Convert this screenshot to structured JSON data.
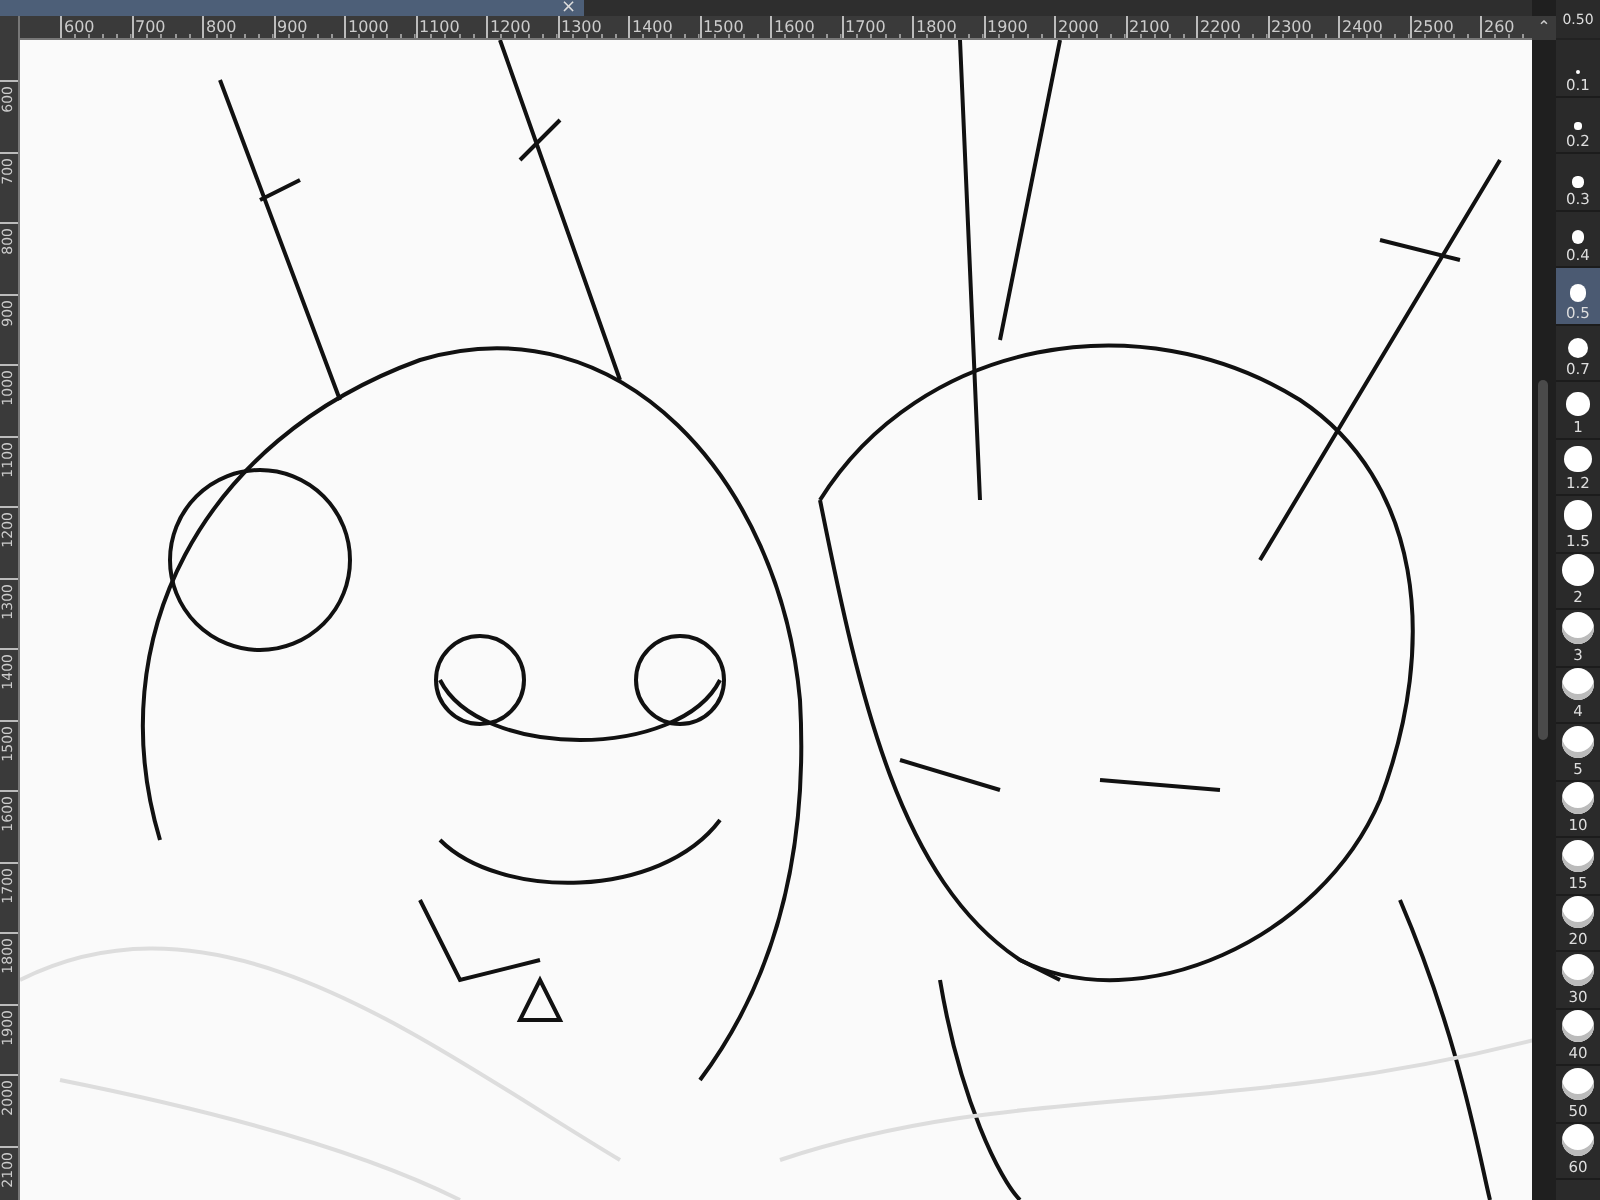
{
  "document_tab": {
    "close_glyph": "×"
  },
  "scroll_up_glyph": "⌃",
  "top_ruler": [
    "600",
    "700",
    "800",
    "900",
    "1000",
    "1100",
    "1200",
    "1300",
    "1400",
    "1500",
    "1600",
    "1700",
    "1800",
    "1900",
    "2000",
    "2100",
    "2200",
    "2300",
    "2400",
    "2500",
    "260"
  ],
  "left_ruler": [
    "600",
    "700",
    "800",
    "900",
    "1000",
    "1100",
    "1200",
    "1300",
    "1400",
    "1500",
    "1600",
    "1700",
    "1800",
    "1900",
    "2000",
    "2100"
  ],
  "brush_size_panel": {
    "current": "0.50",
    "sizes": [
      {
        "label": "0.1",
        "selected": false
      },
      {
        "label": "0.2",
        "selected": false
      },
      {
        "label": "0.3",
        "selected": false
      },
      {
        "label": "0.4",
        "selected": false
      },
      {
        "label": "0.5",
        "selected": true
      },
      {
        "label": "0.7",
        "selected": false
      },
      {
        "label": "1",
        "selected": false
      },
      {
        "label": "1.2",
        "selected": false
      },
      {
        "label": "1.5",
        "selected": false
      },
      {
        "label": "2",
        "selected": false
      },
      {
        "label": "3",
        "selected": false
      },
      {
        "label": "4",
        "selected": false
      },
      {
        "label": "5",
        "selected": false
      },
      {
        "label": "10",
        "selected": false
      },
      {
        "label": "15",
        "selected": false
      },
      {
        "label": "20",
        "selected": false
      },
      {
        "label": "30",
        "selected": false
      },
      {
        "label": "40",
        "selected": false
      },
      {
        "label": "50",
        "selected": false
      },
      {
        "label": "60",
        "selected": false
      }
    ]
  }
}
